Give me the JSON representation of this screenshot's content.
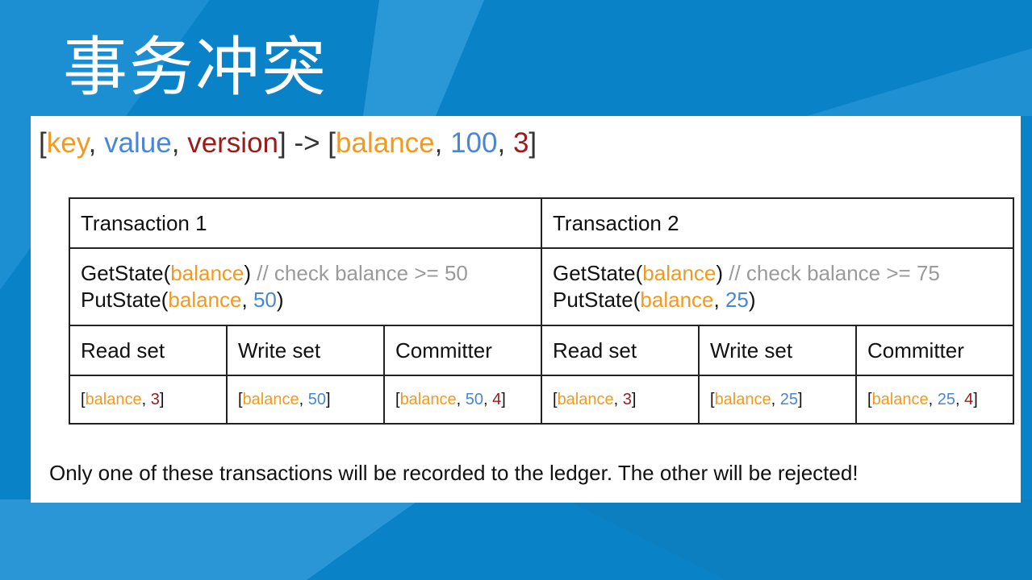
{
  "slide": {
    "title": "事务冲突",
    "footnote": "Only one of these transactions will be recorded to the ledger. The other will be rejected!"
  },
  "kv_line": {
    "open_bracket": "[",
    "key": "key",
    "value": "value",
    "version": "version",
    "arrow": "] -> [",
    "ex_key": "balance",
    "ex_value": "100",
    "ex_version": "3",
    "close_bracket": "]",
    "sep": ", "
  },
  "colors": {
    "background": "#0a82c8",
    "key": "#f29a1f",
    "value": "#4a86d6",
    "version": "#9b1b1b",
    "comment": "#9a9a9a"
  },
  "table": {
    "tx1": {
      "header": "Transaction 1",
      "get_fn": "GetState(",
      "get_arg": "balance",
      "get_close": ")",
      "comment": " // check balance >= 50",
      "put_fn": "PutState(",
      "put_key": "balance",
      "put_val": "50",
      "put_close": ")",
      "read_label": "Read set",
      "write_label": "Write set",
      "committer_label": "Committer",
      "read": {
        "key": "balance",
        "version": "3"
      },
      "write": {
        "key": "balance",
        "value": "50"
      },
      "committer": {
        "key": "balance",
        "value": "50",
        "version": "4"
      }
    },
    "tx2": {
      "header": "Transaction 2",
      "get_fn": "GetState(",
      "get_arg": "balance",
      "get_close": ")",
      "comment": " // check balance >= 75",
      "put_fn": "PutState(",
      "put_key": "balance",
      "put_val": "25",
      "put_close": ")",
      "read_label": "Read set",
      "write_label": "Write set",
      "committer_label": "Committer",
      "read": {
        "key": "balance",
        "version": "3"
      },
      "write": {
        "key": "balance",
        "value": "25"
      },
      "committer": {
        "key": "balance",
        "value": "25",
        "version": "4"
      }
    }
  }
}
